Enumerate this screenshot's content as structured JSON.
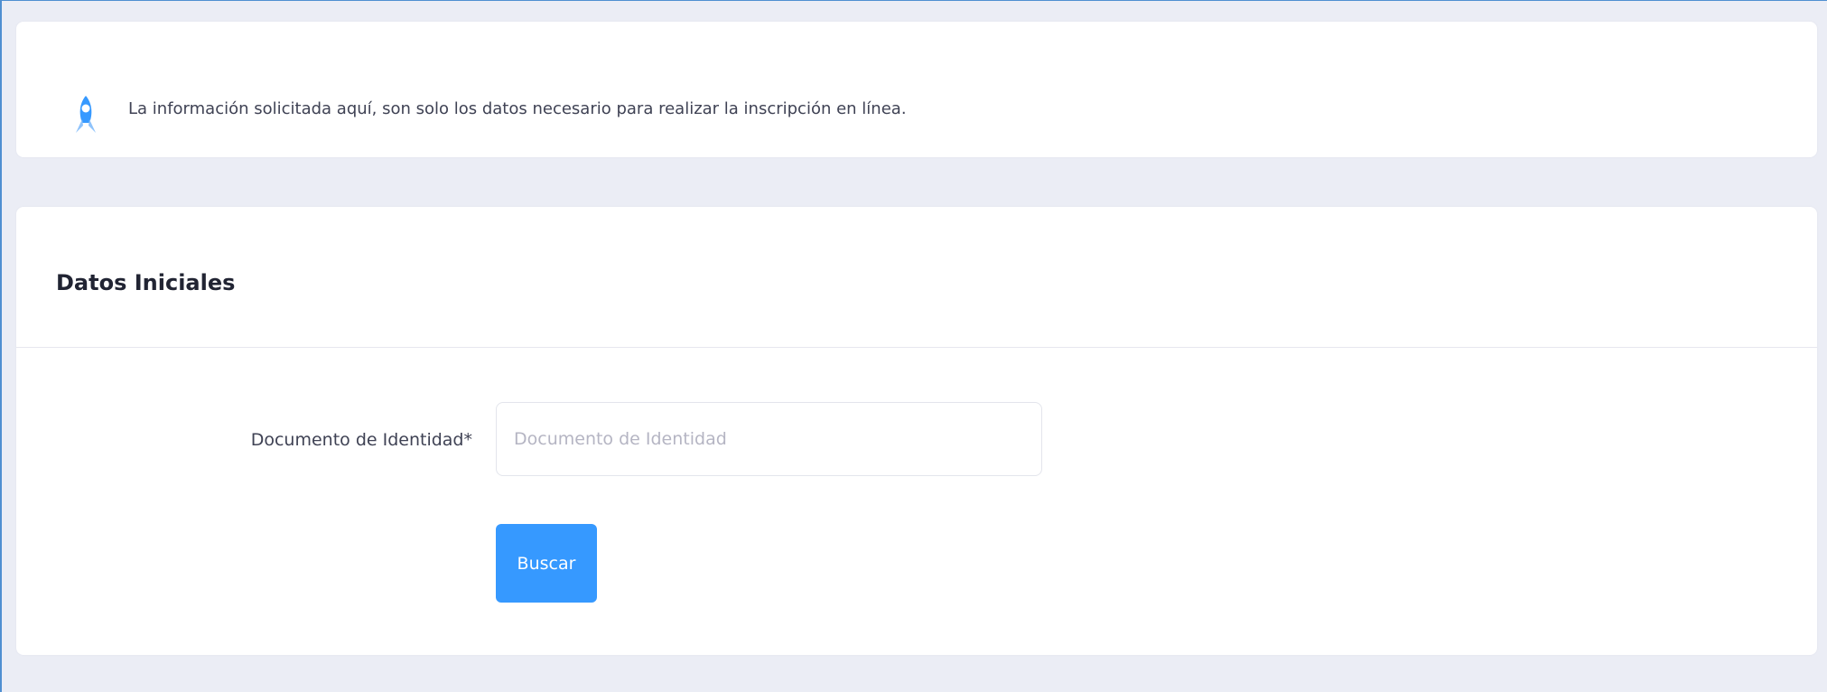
{
  "notice": {
    "text": "La información solicitada aquí, son solo los datos necesario para realizar la inscripción en línea.",
    "icon": "rocket-icon"
  },
  "form": {
    "title": "Datos Iniciales",
    "document_label": "Documento de Identidad*",
    "document_placeholder": "Documento de Identidad",
    "document_value": "",
    "search_label": "Buscar"
  },
  "colors": {
    "background": "#ebedf5",
    "card": "#ffffff",
    "primary": "#3699ff",
    "icon": "#3699ff",
    "frame_border": "#4f8fd1"
  }
}
